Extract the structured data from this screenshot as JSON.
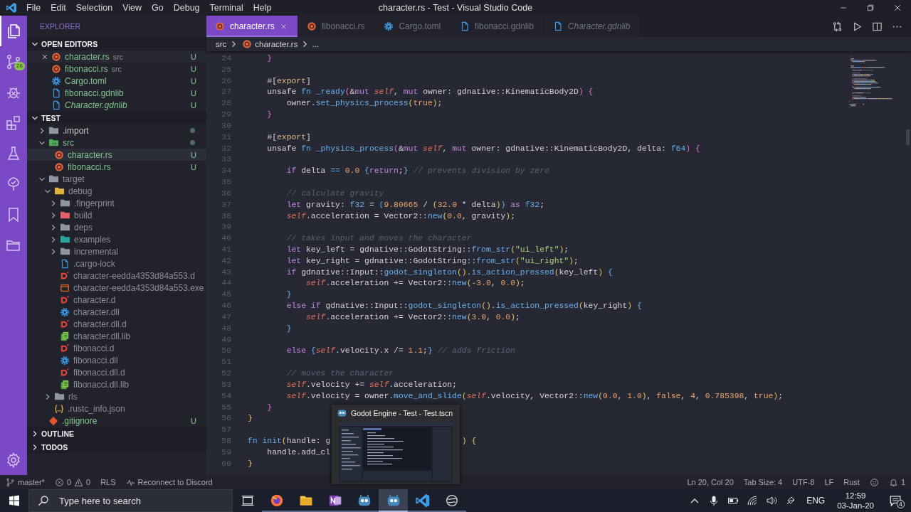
{
  "window": {
    "title": "character.rs - Test - Visual Studio Code"
  },
  "menu": [
    "File",
    "Edit",
    "Selection",
    "View",
    "Go",
    "Debug",
    "Terminal",
    "Help"
  ],
  "activity_bar": [
    {
      "kind": "files",
      "selected": true
    },
    {
      "kind": "source-control",
      "selected": false,
      "badge": "26"
    },
    {
      "kind": "debug",
      "selected": false
    },
    {
      "kind": "extensions",
      "selected": false
    },
    {
      "kind": "test",
      "selected": false
    },
    {
      "kind": "tree",
      "selected": false
    },
    {
      "kind": "bookmark",
      "selected": false
    },
    {
      "kind": "folder",
      "selected": false
    }
  ],
  "sidebar": {
    "title": "EXPLORER",
    "sections": [
      {
        "title": "OPEN EDITORS",
        "expanded": true,
        "kind": "editors",
        "items": [
          {
            "name": "character.rs",
            "detail": "src",
            "kind": "rust",
            "git": "U",
            "color": "#7fc58e",
            "selected": true,
            "preview": false
          },
          {
            "name": "fibonacci.rs",
            "detail": "src",
            "kind": "rust",
            "git": "U",
            "color": "#7fc58e",
            "selected": false,
            "preview": false
          },
          {
            "name": "Cargo.toml",
            "kind": "gear",
            "git": "U",
            "color": "#7fc58e",
            "selected": false,
            "preview": false
          },
          {
            "name": "fibonacci.gdnlib",
            "kind": "doc",
            "git": "U",
            "color": "#7fc58e",
            "selected": false,
            "preview": false
          },
          {
            "name": "Character.gdnlib",
            "kind": "doc",
            "git": "U",
            "color": "#7fc58e",
            "selected": false,
            "preview": true
          }
        ]
      },
      {
        "title": "TEST",
        "expanded": true,
        "kind": "tree",
        "items": [
          {
            "name": ".import",
            "kind": "folder",
            "color": "#c9c9c9",
            "expanded": false,
            "dot": true,
            "selected": false
          },
          {
            "name": "src",
            "kind": "folder-src",
            "color": "#7fc58e",
            "expanded": true,
            "dot": true,
            "selected": false,
            "children": [
              {
                "name": "character.rs",
                "kind": "rust",
                "color": "#7fc58e",
                "git": "U",
                "selected": true
              },
              {
                "name": "fibonacci.rs",
                "kind": "rust",
                "color": "#7fc58e",
                "git": "U",
                "selected": false
              }
            ]
          },
          {
            "name": "target",
            "kind": "folder",
            "color": "#8b8f99",
            "expanded": true,
            "selected": false,
            "children": [
              {
                "name": "debug",
                "kind": "folder-debug",
                "color": "#8b8f99",
                "expanded": true,
                "selected": false,
                "children": [
                  {
                    "name": ".fingerprint",
                    "kind": "folder",
                    "color": "#8b8f99",
                    "expanded": false,
                    "selected": false
                  },
                  {
                    "name": "build",
                    "kind": "folder-build",
                    "color": "#8b8f99",
                    "expanded": false,
                    "selected": false
                  },
                  {
                    "name": "deps",
                    "kind": "folder",
                    "color": "#8b8f99",
                    "expanded": false,
                    "selected": false
                  },
                  {
                    "name": "examples",
                    "kind": "folder-examples",
                    "color": "#8b8f99",
                    "expanded": false,
                    "selected": false
                  },
                  {
                    "name": "incremental",
                    "kind": "folder",
                    "color": "#8b8f99",
                    "expanded": false,
                    "selected": false
                  },
                  {
                    "name": ".cargo-lock",
                    "kind": "doc",
                    "color": "#8b8f99",
                    "selected": false
                  },
                  {
                    "name": "character-eedda4353d84a553.d",
                    "kind": "dfile",
                    "color": "#8b8f99",
                    "selected": false
                  },
                  {
                    "name": "character-eedda4353d84a553.exe",
                    "kind": "exe",
                    "color": "#8b8f99",
                    "selected": false
                  },
                  {
                    "name": "character.d",
                    "kind": "dfile",
                    "color": "#8b8f99",
                    "selected": false
                  },
                  {
                    "name": "character.dll",
                    "kind": "gear",
                    "color": "#8b8f99",
                    "selected": false
                  },
                  {
                    "name": "character.dll.d",
                    "kind": "dfile",
                    "color": "#8b8f99",
                    "selected": false
                  },
                  {
                    "name": "character.dll.lib",
                    "kind": "lib",
                    "color": "#8b8f99",
                    "selected": false
                  },
                  {
                    "name": "fibonacci.d",
                    "kind": "dfile",
                    "color": "#8b8f99",
                    "selected": false
                  },
                  {
                    "name": "fibonacci.dll",
                    "kind": "gear",
                    "color": "#8b8f99",
                    "selected": false
                  },
                  {
                    "name": "fibonacci.dll.d",
                    "kind": "dfile",
                    "color": "#8b8f99",
                    "selected": false
                  },
                  {
                    "name": "fibonacci.dll.lib",
                    "kind": "lib",
                    "color": "#8b8f99",
                    "selected": false
                  }
                ]
              },
              {
                "name": "rls",
                "kind": "folder",
                "color": "#8b8f99",
                "expanded": false,
                "selected": false
              },
              {
                "name": ".rustc_info.json",
                "kind": "json",
                "color": "#8b8f99",
                "selected": false
              }
            ]
          },
          {
            "name": ".gitignore",
            "kind": "git",
            "color": "#7fc58e",
            "git": "U",
            "selected": false
          }
        ]
      },
      {
        "title": "OUTLINE",
        "expanded": false
      },
      {
        "title": "TODOS",
        "expanded": false
      }
    ]
  },
  "tabs": [
    {
      "label": "character.rs",
      "kind": "rust",
      "selected": true,
      "preview": false
    },
    {
      "label": "fibonacci.rs",
      "kind": "rust",
      "selected": false,
      "preview": false
    },
    {
      "label": "Cargo.toml",
      "kind": "gear",
      "selected": false,
      "preview": false
    },
    {
      "label": "fibonacci.gdnlib",
      "kind": "doc",
      "selected": false,
      "preview": false
    },
    {
      "label": "Character.gdnlib",
      "kind": "doc",
      "selected": false,
      "preview": true
    }
  ],
  "breadcrumb": [
    {
      "label": "src"
    },
    {
      "label": "character.rs",
      "kind": "rust"
    },
    {
      "label": "..."
    }
  ],
  "editor": {
    "lines": [
      {
        "number": "24",
        "tokens": [
          {
            "kind": "brace",
            "text": "    }"
          }
        ]
      },
      {
        "number": "25"
      },
      {
        "number": "26",
        "tokens": [
          {
            "kind": "plain",
            "text": "    #["
          },
          {
            "kind": "attribute",
            "text": "export"
          },
          {
            "kind": "plain",
            "text": "]"
          }
        ]
      },
      {
        "number": "27",
        "tokens": [
          {
            "kind": "plain",
            "text": "    unsafe "
          },
          {
            "kind": "function",
            "text": "fn _ready"
          },
          {
            "kind": "brace",
            "text": "("
          },
          {
            "kind": "plain",
            "text": "&"
          },
          {
            "kind": "keyword",
            "text": "mut "
          },
          {
            "kind": "self",
            "text": "self"
          },
          {
            "kind": "plain",
            "text": ", "
          },
          {
            "kind": "keyword",
            "text": "mut"
          },
          {
            "kind": "plain",
            "text": " owner: gdnative::KinematicBody2D"
          },
          {
            "kind": "brace",
            "text": ")"
          },
          {
            "kind": "brace",
            "text": " {"
          }
        ]
      },
      {
        "number": "28",
        "tokens": [
          {
            "kind": "plain",
            "text": "        owner."
          },
          {
            "kind": "function",
            "text": "set_physics_process"
          },
          {
            "kind": "paren",
            "text": "("
          },
          {
            "kind": "number",
            "text": "true"
          },
          {
            "kind": "paren",
            "text": ")"
          },
          {
            "kind": "plain",
            "text": ";"
          }
        ]
      },
      {
        "number": "29",
        "tokens": [
          {
            "kind": "brace",
            "text": "    }"
          }
        ]
      },
      {
        "number": "30"
      },
      {
        "number": "31",
        "tokens": [
          {
            "kind": "plain",
            "text": "    #["
          },
          {
            "kind": "attribute",
            "text": "export"
          },
          {
            "kind": "plain",
            "text": "]"
          }
        ]
      },
      {
        "number": "32",
        "tokens": [
          {
            "kind": "plain",
            "text": "    unsafe "
          },
          {
            "kind": "function",
            "text": "fn _physics_process"
          },
          {
            "kind": "brace",
            "text": "("
          },
          {
            "kind": "plain",
            "text": "&"
          },
          {
            "kind": "keyword",
            "text": "mut "
          },
          {
            "kind": "self",
            "text": "self"
          },
          {
            "kind": "plain",
            "text": ", "
          },
          {
            "kind": "keyword",
            "text": "mut"
          },
          {
            "kind": "plain",
            "text": " owner: gdnative::KinematicBody2D, delta: "
          },
          {
            "kind": "function",
            "text": "f64"
          },
          {
            "kind": "brace",
            "text": ")"
          },
          {
            "kind": "brace",
            "text": " {"
          }
        ]
      },
      {
        "number": "33"
      },
      {
        "number": "34",
        "tokens": [
          {
            "kind": "keyword",
            "text": "        if"
          },
          {
            "kind": "plain",
            "text": " delta "
          },
          {
            "kind": "function",
            "text": "=="
          },
          {
            "kind": "number",
            "text": " 0.0"
          },
          {
            "kind": "function",
            "text": " {"
          },
          {
            "kind": "keyword",
            "text": "return"
          },
          {
            "kind": "plain",
            "text": ";"
          },
          {
            "kind": "function",
            "text": "}"
          },
          {
            "kind": "comment",
            "text": " // prevents division by zero"
          }
        ]
      },
      {
        "number": "35"
      },
      {
        "number": "36",
        "tokens": [
          {
            "kind": "comment",
            "text": "        // calculate gravity"
          }
        ]
      },
      {
        "number": "37",
        "tokens": [
          {
            "kind": "keyword",
            "text": "        let"
          },
          {
            "kind": "plain",
            "text": " gravity: "
          },
          {
            "kind": "function",
            "text": "f32"
          },
          {
            "kind": "plain",
            "text": " = "
          },
          {
            "kind": "function",
            "text": "("
          },
          {
            "kind": "number",
            "text": "9.80665"
          },
          {
            "kind": "plain",
            "text": " / "
          },
          {
            "kind": "paren",
            "text": "("
          },
          {
            "kind": "number",
            "text": "32.0"
          },
          {
            "kind": "plain",
            "text": " * delta"
          },
          {
            "kind": "paren",
            "text": ")"
          },
          {
            "kind": "function",
            "text": ")"
          },
          {
            "kind": "keyword",
            "text": " as"
          },
          {
            "kind": "function",
            "text": " f32"
          },
          {
            "kind": "plain",
            "text": ";"
          }
        ]
      },
      {
        "number": "38",
        "tokens": [
          {
            "kind": "self",
            "text": "        self"
          },
          {
            "kind": "plain",
            "text": ".acceleration = Vector2::"
          },
          {
            "kind": "function",
            "text": "new"
          },
          {
            "kind": "paren",
            "text": "("
          },
          {
            "kind": "number",
            "text": "0.0"
          },
          {
            "kind": "plain",
            "text": ", gravity"
          },
          {
            "kind": "paren",
            "text": ")"
          },
          {
            "kind": "plain",
            "text": ";"
          }
        ]
      },
      {
        "number": "39"
      },
      {
        "number": "40",
        "tokens": [
          {
            "kind": "comment",
            "text": "        // takes input and moves the character"
          }
        ]
      },
      {
        "number": "41",
        "tokens": [
          {
            "kind": "keyword",
            "text": "        let"
          },
          {
            "kind": "plain",
            "text": " key_left = gdnative::GodotString::"
          },
          {
            "kind": "function",
            "text": "from_str"
          },
          {
            "kind": "paren",
            "text": "("
          },
          {
            "kind": "string",
            "text": "\"ui_left\""
          },
          {
            "kind": "paren",
            "text": ")"
          },
          {
            "kind": "plain",
            "text": ";"
          }
        ]
      },
      {
        "number": "42",
        "tokens": [
          {
            "kind": "keyword",
            "text": "        let"
          },
          {
            "kind": "plain",
            "text": " key_right = gdnative::GodotString::"
          },
          {
            "kind": "function",
            "text": "from_str"
          },
          {
            "kind": "paren",
            "text": "("
          },
          {
            "kind": "string",
            "text": "\"ui_right\""
          },
          {
            "kind": "paren",
            "text": ")"
          },
          {
            "kind": "plain",
            "text": ";"
          }
        ]
      },
      {
        "number": "43",
        "tokens": [
          {
            "kind": "keyword",
            "text": "        if"
          },
          {
            "kind": "plain",
            "text": " gdnative::Input::"
          },
          {
            "kind": "function",
            "text": "godot_singleton"
          },
          {
            "kind": "paren",
            "text": "()"
          },
          {
            "kind": "plain",
            "text": "."
          },
          {
            "kind": "function",
            "text": "is_action_pressed"
          },
          {
            "kind": "paren",
            "text": "("
          },
          {
            "kind": "plain",
            "text": "key_left"
          },
          {
            "kind": "paren",
            "text": ")"
          },
          {
            "kind": "function",
            "text": " {"
          }
        ]
      },
      {
        "number": "44",
        "tokens": [
          {
            "kind": "self",
            "text": "            self"
          },
          {
            "kind": "plain",
            "text": ".acceleration += Vector2::"
          },
          {
            "kind": "function",
            "text": "new"
          },
          {
            "kind": "paren",
            "text": "("
          },
          {
            "kind": "number",
            "text": "-3.0"
          },
          {
            "kind": "plain",
            "text": ", "
          },
          {
            "kind": "number",
            "text": "0.0"
          },
          {
            "kind": "paren",
            "text": ")"
          },
          {
            "kind": "plain",
            "text": ";"
          }
        ]
      },
      {
        "number": "45",
        "tokens": [
          {
            "kind": "function",
            "text": "        }"
          }
        ]
      },
      {
        "number": "46",
        "tokens": [
          {
            "kind": "keyword",
            "text": "        else if"
          },
          {
            "kind": "plain",
            "text": " gdnative::Input::"
          },
          {
            "kind": "function",
            "text": "godot_singleton"
          },
          {
            "kind": "paren",
            "text": "()"
          },
          {
            "kind": "plain",
            "text": "."
          },
          {
            "kind": "function",
            "text": "is_action_pressed"
          },
          {
            "kind": "paren",
            "text": "("
          },
          {
            "kind": "plain",
            "text": "key_right"
          },
          {
            "kind": "paren",
            "text": ")"
          },
          {
            "kind": "function",
            "text": " {"
          }
        ]
      },
      {
        "number": "47",
        "tokens": [
          {
            "kind": "self",
            "text": "            self"
          },
          {
            "kind": "plain",
            "text": ".acceleration += Vector2::"
          },
          {
            "kind": "function",
            "text": "new"
          },
          {
            "kind": "paren",
            "text": "("
          },
          {
            "kind": "number",
            "text": "3.0"
          },
          {
            "kind": "plain",
            "text": ", "
          },
          {
            "kind": "number",
            "text": "0.0"
          },
          {
            "kind": "paren",
            "text": ")"
          },
          {
            "kind": "plain",
            "text": ";"
          }
        ]
      },
      {
        "number": "48",
        "tokens": [
          {
            "kind": "function",
            "text": "        }"
          }
        ]
      },
      {
        "number": "49"
      },
      {
        "number": "50",
        "tokens": [
          {
            "kind": "keyword",
            "text": "        else"
          },
          {
            "kind": "function",
            "text": " {"
          },
          {
            "kind": "self",
            "text": "self"
          },
          {
            "kind": "plain",
            "text": ".velocity.x /= "
          },
          {
            "kind": "number",
            "text": "1.1"
          },
          {
            "kind": "plain",
            "text": ";"
          },
          {
            "kind": "function",
            "text": "}"
          },
          {
            "kind": "comment",
            "text": " // adds friction"
          }
        ]
      },
      {
        "number": "51"
      },
      {
        "number": "52",
        "tokens": [
          {
            "kind": "comment",
            "text": "        // moves the character"
          }
        ]
      },
      {
        "number": "53",
        "tokens": [
          {
            "kind": "self",
            "text": "        self"
          },
          {
            "kind": "plain",
            "text": ".velocity += "
          },
          {
            "kind": "self",
            "text": "self"
          },
          {
            "kind": "plain",
            "text": ".acceleration;"
          }
        ]
      },
      {
        "number": "54",
        "tokens": [
          {
            "kind": "self",
            "text": "        self"
          },
          {
            "kind": "plain",
            "text": ".velocity = owner."
          },
          {
            "kind": "function",
            "text": "move_and_slide"
          },
          {
            "kind": "paren",
            "text": "("
          },
          {
            "kind": "self",
            "text": "self"
          },
          {
            "kind": "plain",
            "text": ".velocity, Vector2::"
          },
          {
            "kind": "function",
            "text": "new"
          },
          {
            "kind": "paren",
            "text": "("
          },
          {
            "kind": "number",
            "text": "0.0"
          },
          {
            "kind": "plain",
            "text": ", "
          },
          {
            "kind": "number",
            "text": "1.0"
          },
          {
            "kind": "paren",
            "text": ")"
          },
          {
            "kind": "plain",
            "text": ", "
          },
          {
            "kind": "number",
            "text": "false"
          },
          {
            "kind": "plain",
            "text": ", "
          },
          {
            "kind": "number",
            "text": "4"
          },
          {
            "kind": "plain",
            "text": ", "
          },
          {
            "kind": "number",
            "text": "0.785398"
          },
          {
            "kind": "plain",
            "text": ", "
          },
          {
            "kind": "number",
            "text": "true"
          },
          {
            "kind": "paren",
            "text": ")"
          },
          {
            "kind": "plain",
            "text": ";"
          }
        ]
      },
      {
        "number": "55",
        "tokens": [
          {
            "kind": "brace",
            "text": "    }"
          }
        ]
      },
      {
        "number": "56",
        "tokens": [
          {
            "kind": "paren",
            "text": "}"
          }
        ]
      },
      {
        "number": "57"
      },
      {
        "number": "58",
        "tokens": [
          {
            "kind": "function",
            "text": "fn init"
          },
          {
            "kind": "paren",
            "text": "("
          },
          {
            "kind": "plain",
            "text": "handle: g"
          },
          {
            "kind": "gap"
          },
          {
            "kind": "paren",
            "text": ") {"
          }
        ]
      },
      {
        "number": "59",
        "tokens": [
          {
            "kind": "plain",
            "text": "    handle.add_cl"
          }
        ]
      },
      {
        "number": "60",
        "tokens": [
          {
            "kind": "paren",
            "text": "}"
          }
        ]
      }
    ]
  },
  "preview_popup": {
    "title": "Godot Engine - Test - Test.tscn"
  },
  "status_bar": {
    "branch": "master*",
    "errors": "0",
    "warnings": "0",
    "language_server": "RLS",
    "discord": "Reconnect to Discord",
    "position": "Ln 20, Col 20",
    "tab_size": "Tab Size: 4",
    "encoding": "UTF-8",
    "eol": "LF",
    "language": "Rust",
    "notifications": "1"
  },
  "taskbar": {
    "search": {
      "placeholder": "Type here to search"
    },
    "apps": [
      {
        "kind": "task-view",
        "hovered": false
      },
      {
        "kind": "browser",
        "hovered": false
      },
      {
        "kind": "files",
        "hovered": false
      },
      {
        "kind": "notes",
        "hovered": false
      },
      {
        "kind": "godot",
        "hovered": false
      },
      {
        "kind": "godot",
        "hovered": true
      },
      {
        "kind": "editor",
        "hovered": false
      },
      {
        "kind": "ring",
        "hovered": false
      }
    ],
    "tray": {
      "language": "ENG",
      "time": "12:59",
      "date": "03-Jan-20",
      "notifications": "4"
    }
  }
}
